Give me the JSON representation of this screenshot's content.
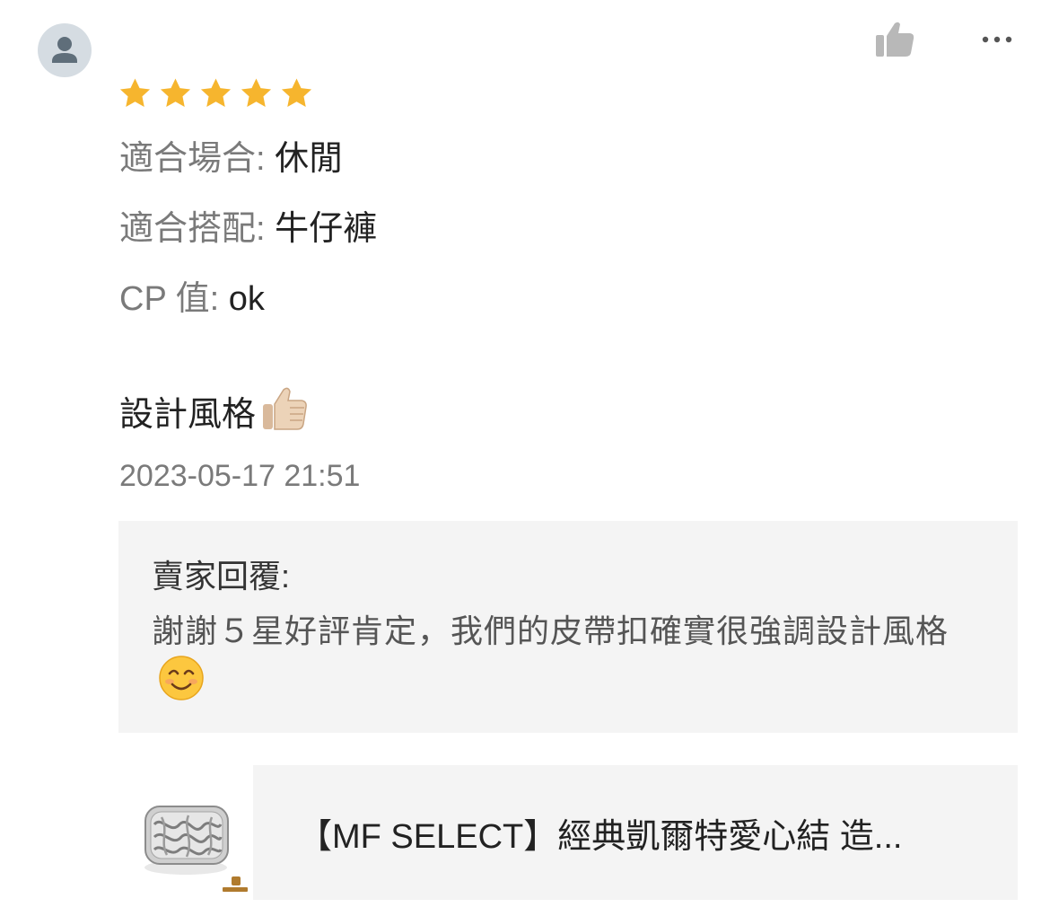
{
  "review": {
    "rating": 5,
    "rating_max": 5,
    "attributes": [
      {
        "key": "適合場合: ",
        "value": "休閒"
      },
      {
        "key": "適合搭配: ",
        "value": "牛仔褲"
      },
      {
        "key": "CP 值: ",
        "value": "ok"
      }
    ],
    "comment": "設計風格",
    "comment_emoji": "thumbs-up-icon",
    "timestamp": "2023-05-17 21:51"
  },
  "seller_reply": {
    "label": "賣家回覆:",
    "text": "謝謝５星好評肯定，我們的皮帶扣確實很強調設計風格",
    "emoji": "smiling-face-icon"
  },
  "product": {
    "title": "【MF SELECT】經典凱爾特愛心結 造...",
    "thumbnail_icon": "belt-buckle-image",
    "thumbnail_brand": "MF select"
  },
  "icons": {
    "avatar": "user-avatar-icon",
    "like": "thumbs-up-outline-icon",
    "more": "more-dots-icon"
  },
  "colors": {
    "star": "#f6b52e",
    "muted_text": "#7a7a7a",
    "panel_bg": "#f4f4f4",
    "icon_gray": "#b8b8b8"
  }
}
